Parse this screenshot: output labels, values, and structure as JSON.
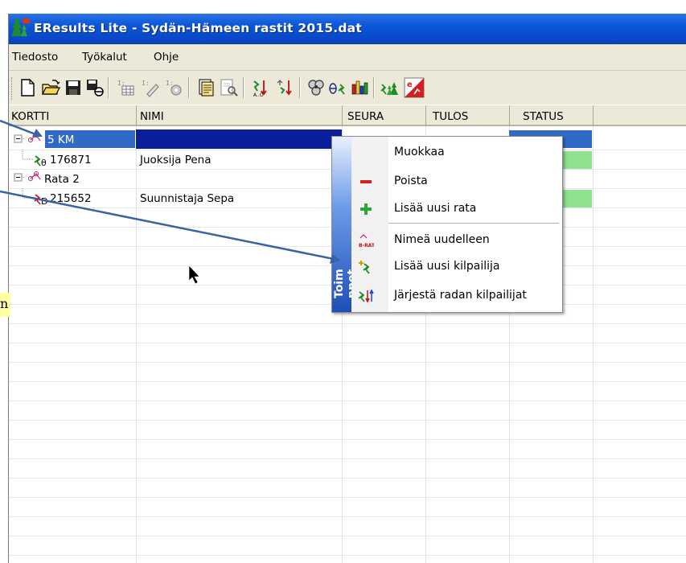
{
  "window": {
    "title": "EResults Lite - Sydän-Hämeen rastit 2015.dat"
  },
  "menubar": {
    "items": [
      "Tiedosto",
      "Työkalut",
      "Ohje"
    ]
  },
  "toolbar": {
    "buttons": [
      "new-file-icon",
      "open-folder-icon",
      "save-disk-icon",
      "save-as-icon",
      "table-report-icon",
      "edit-list-icon",
      "settings-list-icon",
      "print-preview-icon",
      "search-document-icon",
      "sort-az-icon",
      "sort-rank-icon",
      "gear-cluster-icon",
      "theta-runner-icon",
      "bar-chart-icon",
      "runners-forest-icon",
      "export-results-icon"
    ]
  },
  "grid": {
    "columns": [
      "KORTTI",
      "NIMI",
      "SEURA",
      "TULOS",
      "STATUS"
    ],
    "rows": [
      {
        "type": "course",
        "kortti": "5 KM",
        "nimi": "",
        "expanded": true,
        "selected": true
      },
      {
        "type": "runner",
        "kortti": "176871",
        "nimi": "Juoksija Pena",
        "status_color": "#90e090"
      },
      {
        "type": "course",
        "kortti": "Rata 2",
        "nimi": "",
        "expanded": true
      },
      {
        "type": "runner",
        "kortti": "215652",
        "nimi": "Suunnistaja Sepa",
        "status_color": "#90e090"
      }
    ]
  },
  "context_menu": {
    "band_label": "Toimenpiteet",
    "band_visible_text": "Toim  nnot",
    "items": [
      {
        "label": "Muokkaa",
        "icon": "none"
      },
      {
        "label": "Poista",
        "icon": "minus-icon"
      },
      {
        "label": "Lisää uusi rata",
        "icon": "plus-icon"
      },
      {
        "label": "Nimeä uudelleen",
        "icon": "rename-course-icon"
      },
      {
        "label": "Lisää uusi kilpailija",
        "icon": "add-runner-icon"
      },
      {
        "label": "Järjestä radan kilpailijat",
        "icon": "sort-runners-icon"
      }
    ]
  },
  "colors": {
    "titlebar": "#0a4fd0",
    "selection_dark": "#0a1e9c",
    "selection": "#316ac5",
    "status_ok": "#90e090",
    "arrow": "#3a62a6"
  }
}
